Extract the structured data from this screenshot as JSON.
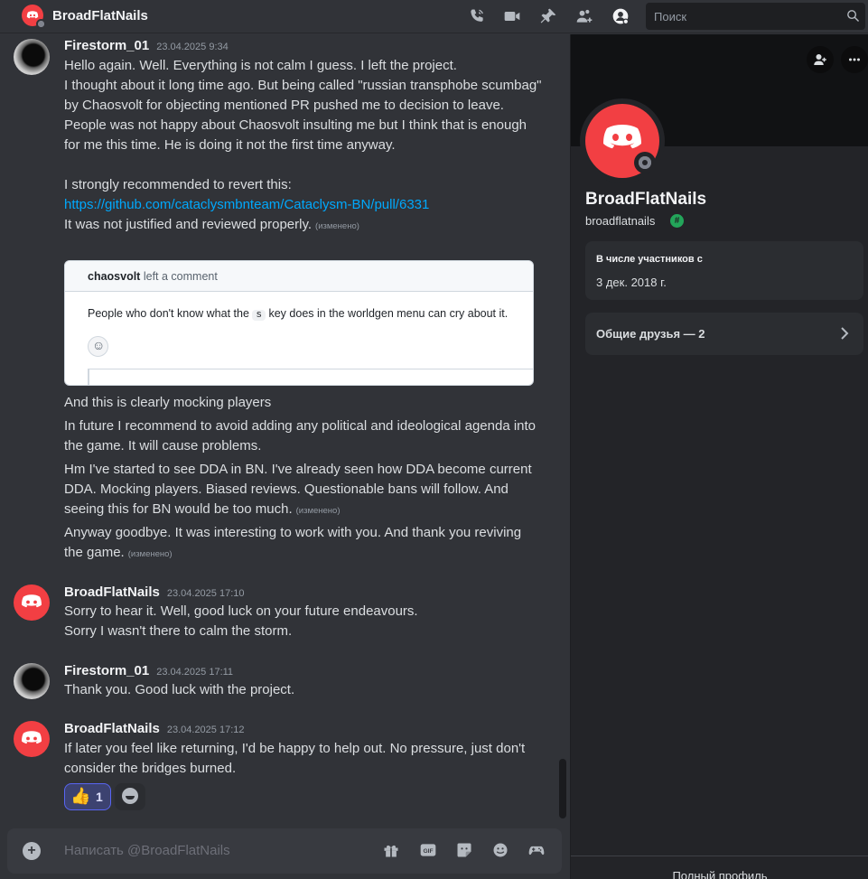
{
  "header": {
    "title": "BroadFlatNails",
    "search_placeholder": "Поиск",
    "icons": [
      "voice-call-icon",
      "video-call-icon",
      "pin-icon",
      "add-friends-icon",
      "user-profile-icon",
      "search-icon"
    ]
  },
  "messages": [
    {
      "author": "Firestorm_01",
      "timestamp": "23.04.2025 9:34",
      "lines": [
        "Hello again. Well. Everything is not calm I guess. I left the project.",
        "I thought about it long time ago. But being called \"russian transphobe scumbag\" by Chaosvolt for objecting mentioned PR pushed me to decision to leave.",
        "People was not happy about Chaosvolt insulting me but I think that is enough for me this time. He is doing it not the first time anyway.",
        "I strongly recommended to revert this:",
        "https://github.com/cataclysmbnteam/Cataclysm-BN/pull/6331",
        "It was not justified and reviewed properly."
      ],
      "edited_label": "(изменено)",
      "embed": {
        "comment_author": "chaosvolt",
        "comment_suffix": "left a comment",
        "comment_text_before": "People who don't know what the",
        "comment_key": "s",
        "comment_text_after": "key does in the worldgen menu can cry about it."
      },
      "followups": [
        "And this is clearly mocking players",
        "In future I recommend to avoid adding any political and ideological agenda into the game. It will cause problems.",
        "Hm I've started to see DDA in BN. I've already seen how DDA become current DDA. Mocking players. Biased reviews. Questionable bans will follow. And seeing this for BN would be too much.",
        "Anyway goodbye. It was interesting to work with you. And thank you reviving the game."
      ]
    },
    {
      "author": "BroadFlatNails",
      "timestamp": "23.04.2025 17:10",
      "lines": [
        "Sorry to hear it. Well, good luck on your future endeavours.",
        "Sorry I wasn't there to calm the storm."
      ]
    },
    {
      "author": "Firestorm_01",
      "timestamp": "23.04.2025 17:11",
      "lines": [
        "Thank you. Good luck with the project."
      ]
    },
    {
      "author": "BroadFlatNails",
      "timestamp": "23.04.2025 17:12",
      "lines": [
        "If later you feel like returning, I'd be happy to help out. No pressure, just don't consider the bridges burned."
      ],
      "reactions": [
        {
          "emoji": "👍",
          "count": "1"
        }
      ]
    }
  ],
  "composer": {
    "placeholder": "Написать @BroadFlatNails",
    "icons": [
      "gift-icon",
      "gif-icon",
      "sticker-icon",
      "emoji-icon",
      "activities-icon"
    ]
  },
  "profile": {
    "display_name": "BroadFlatNails",
    "username": "broadflatnails",
    "badge": "#",
    "member_since_label": "В числе участников с",
    "member_since_value": "3 дек. 2018 г.",
    "mutual_friends": "Общие друзья — 2",
    "full_profile": "Полный профиль"
  },
  "colors": {
    "background": "#313338",
    "profile_bg": "#232428",
    "accent": "#5865f2",
    "discord_red": "#f23f43",
    "link": "#00a8fc"
  }
}
